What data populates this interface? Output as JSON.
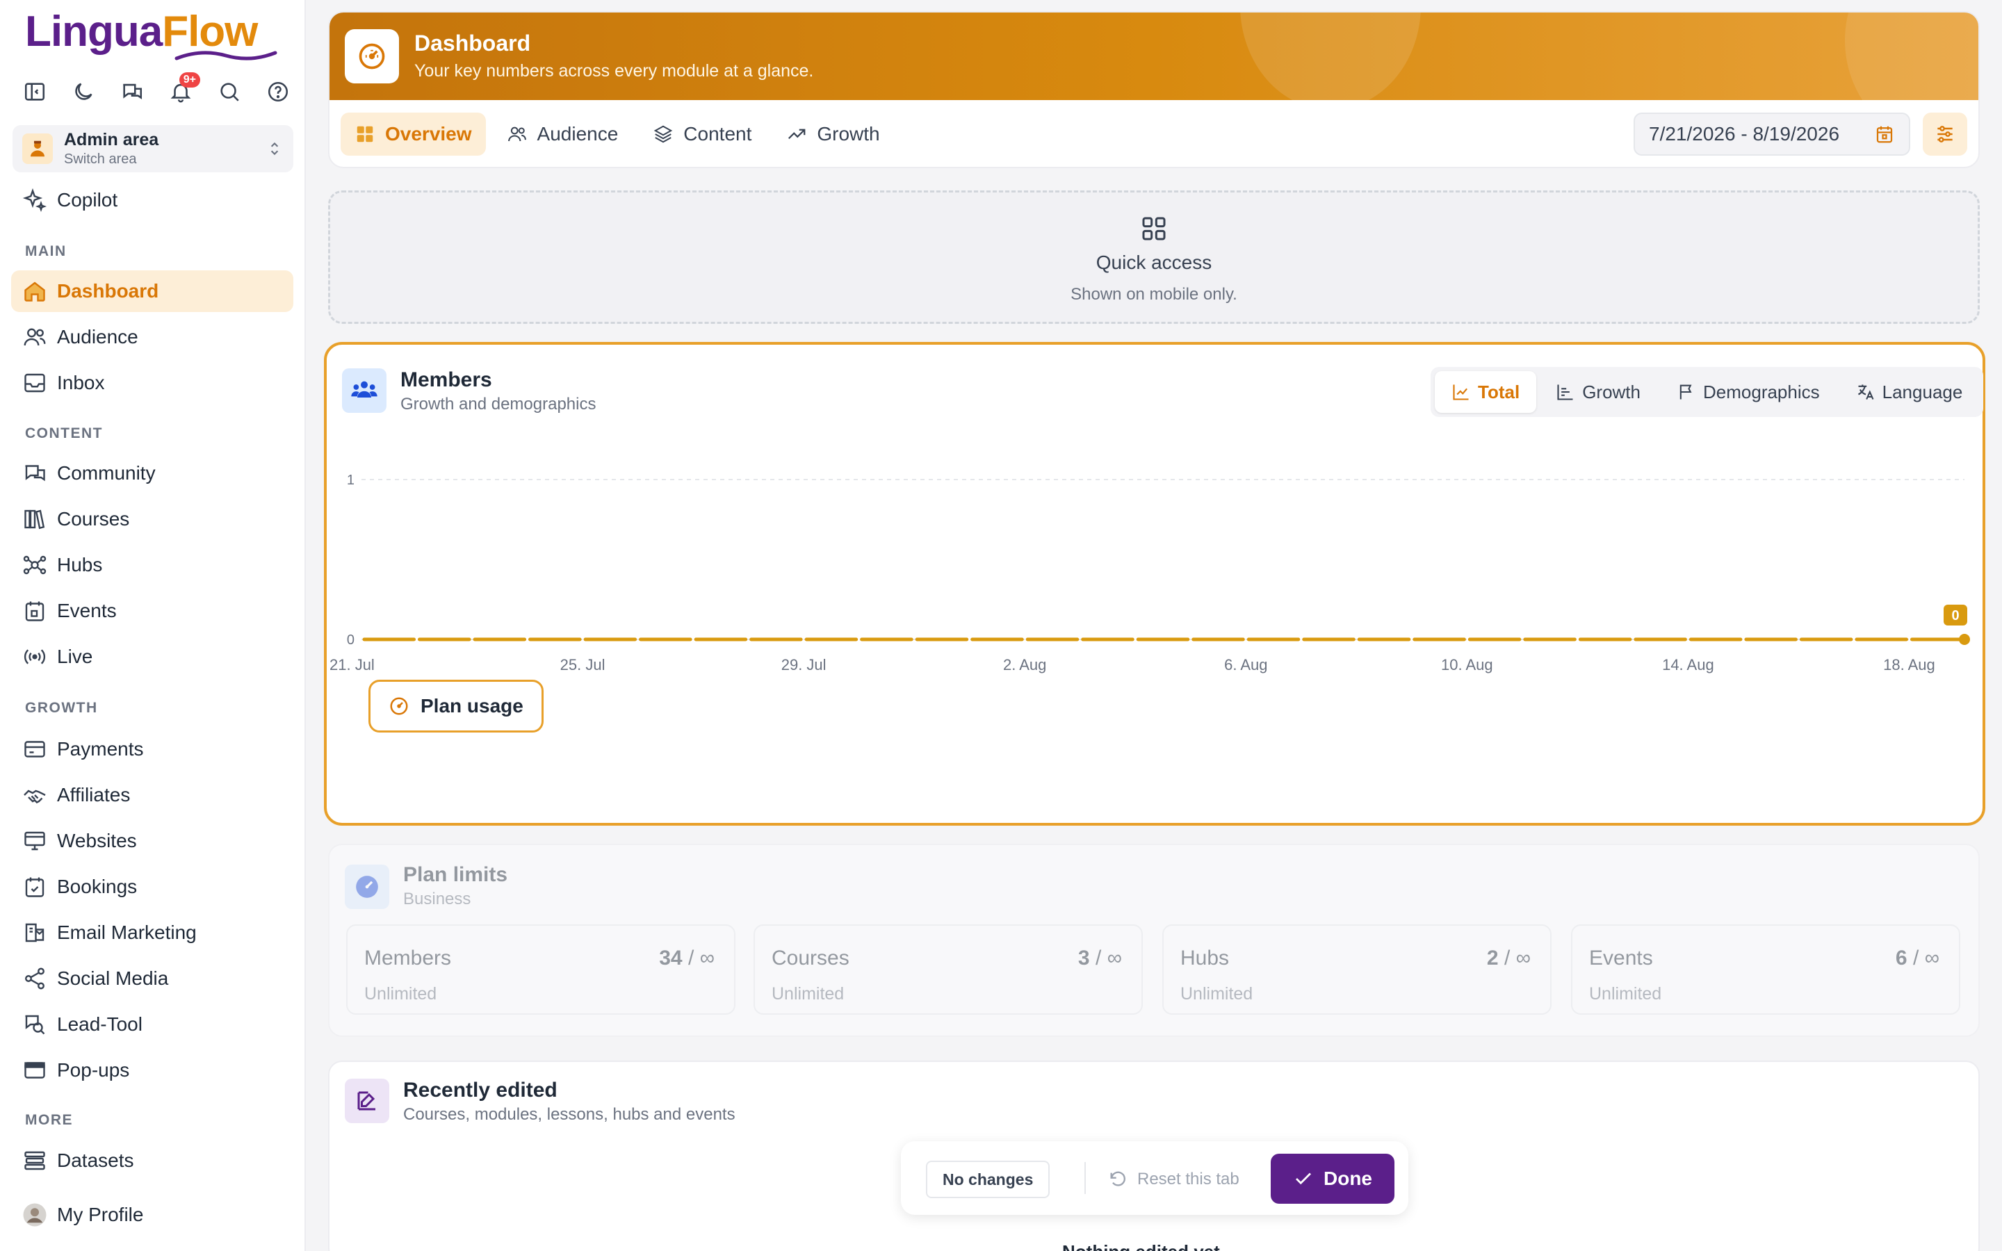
{
  "app": {
    "logo_part1": "Lingua",
    "logo_part2": "Flow",
    "notification_count": "9+"
  },
  "area": {
    "title": "Admin area",
    "subtitle": "Switch area"
  },
  "sidebar": {
    "copilot": "Copilot",
    "sections": {
      "main": "MAIN",
      "content": "CONTENT",
      "growth": "GROWTH",
      "more": "MORE"
    },
    "items": {
      "dashboard": "Dashboard",
      "audience": "Audience",
      "inbox": "Inbox",
      "community": "Community",
      "courses": "Courses",
      "hubs": "Hubs",
      "events": "Events",
      "live": "Live",
      "payments": "Payments",
      "affiliates": "Affiliates",
      "websites": "Websites",
      "bookings": "Bookings",
      "email_marketing": "Email Marketing",
      "social_media": "Social Media",
      "lead_tool": "Lead-Tool",
      "popups": "Pop-ups",
      "datasets": "Datasets",
      "my_profile": "My Profile"
    }
  },
  "header": {
    "title": "Dashboard",
    "subtitle": "Your key numbers across every module at a glance.",
    "tabs": [
      "Overview",
      "Audience",
      "Content",
      "Growth"
    ],
    "date_range": "7/21/2026 - 8/19/2026"
  },
  "quick_access": {
    "title": "Quick access",
    "subtitle": "Shown on mobile only."
  },
  "members": {
    "title": "Members",
    "subtitle": "Growth and demographics",
    "seg": [
      "Total",
      "Growth",
      "Demographics",
      "Language"
    ],
    "plan_usage": "Plan usage"
  },
  "chart_data": {
    "type": "line",
    "x": [
      "21. Jul",
      "25. Jul",
      "29. Jul",
      "2. Aug",
      "6. Aug",
      "10. Aug",
      "14. Aug",
      "18. Aug"
    ],
    "y_ticks": [
      "0",
      "1"
    ],
    "ylim": [
      0,
      1
    ],
    "series": [
      {
        "values": [
          0,
          0,
          0,
          0,
          0,
          0,
          0,
          0
        ],
        "last_label": "0"
      }
    ],
    "grid": true,
    "color": "#d99a0f"
  },
  "plan_limits": {
    "title": "Plan limits",
    "subtitle": "Business",
    "items": [
      {
        "name": "Members",
        "value": "34",
        "limit": "/ ∞",
        "sub": "Unlimited"
      },
      {
        "name": "Courses",
        "value": "3",
        "limit": "/ ∞",
        "sub": "Unlimited"
      },
      {
        "name": "Hubs",
        "value": "2",
        "limit": "/ ∞",
        "sub": "Unlimited"
      },
      {
        "name": "Events",
        "value": "6",
        "limit": "/ ∞",
        "sub": "Unlimited"
      }
    ]
  },
  "recent": {
    "title": "Recently edited",
    "subtitle": "Courses, modules, lessons, hubs and events",
    "empty": "Nothing edited yet"
  },
  "action_bar": {
    "no_changes": "No changes",
    "reset": "Reset this tab",
    "done": "Done"
  }
}
